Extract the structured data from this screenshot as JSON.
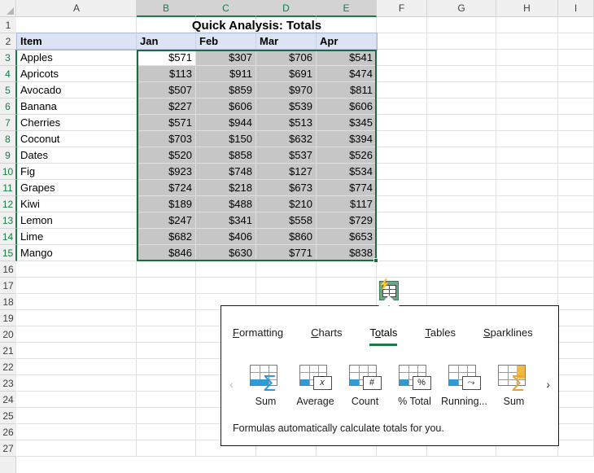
{
  "sheet": {
    "title": "Quick Analysis: Totals",
    "column_headers": [
      "A",
      "B",
      "C",
      "D",
      "E",
      "F",
      "G",
      "H",
      "I"
    ],
    "selected_columns": [
      "B",
      "C",
      "D",
      "E"
    ],
    "row_headers": [
      "1",
      "2",
      "3",
      "4",
      "5",
      "6",
      "7",
      "8",
      "9",
      "10",
      "11",
      "12",
      "13",
      "14",
      "15",
      "16",
      "17",
      "18",
      "19",
      "20",
      "21",
      "22",
      "23",
      "24",
      "25",
      "26",
      "27"
    ],
    "selected_rows": [
      "3",
      "4",
      "5",
      "6",
      "7",
      "8",
      "9",
      "10",
      "11",
      "12",
      "13",
      "14",
      "15"
    ],
    "table_headers": [
      "Item",
      "Jan",
      "Feb",
      "Mar",
      "Apr"
    ],
    "rows": [
      {
        "item": "Apples",
        "jan": "$571",
        "feb": "$307",
        "mar": "$706",
        "apr": "$541"
      },
      {
        "item": "Apricots",
        "jan": "$113",
        "feb": "$911",
        "mar": "$691",
        "apr": "$474"
      },
      {
        "item": "Avocado",
        "jan": "$507",
        "feb": "$859",
        "mar": "$970",
        "apr": "$811"
      },
      {
        "item": "Banana",
        "jan": "$227",
        "feb": "$606",
        "mar": "$539",
        "apr": "$606"
      },
      {
        "item": "Cherries",
        "jan": "$571",
        "feb": "$944",
        "mar": "$513",
        "apr": "$345"
      },
      {
        "item": "Coconut",
        "jan": "$703",
        "feb": "$150",
        "mar": "$632",
        "apr": "$394"
      },
      {
        "item": "Dates",
        "jan": "$520",
        "feb": "$858",
        "mar": "$537",
        "apr": "$526"
      },
      {
        "item": "Fig",
        "jan": "$923",
        "feb": "$748",
        "mar": "$127",
        "apr": "$534"
      },
      {
        "item": "Grapes",
        "jan": "$724",
        "feb": "$218",
        "mar": "$673",
        "apr": "$774"
      },
      {
        "item": "Kiwi",
        "jan": "$189",
        "feb": "$488",
        "mar": "$210",
        "apr": "$117"
      },
      {
        "item": "Lemon",
        "jan": "$247",
        "feb": "$341",
        "mar": "$558",
        "apr": "$729"
      },
      {
        "item": "Lime",
        "jan": "$682",
        "feb": "$406",
        "mar": "$860",
        "apr": "$653"
      },
      {
        "item": "Mango",
        "jan": "$846",
        "feb": "$630",
        "mar": "$771",
        "apr": "$838"
      }
    ],
    "active_cell": "B3",
    "selection_range": "B3:E15"
  },
  "quick_analysis": {
    "button_tooltip": "Quick Analysis",
    "tabs": [
      {
        "label": "Formatting",
        "accel": "F",
        "accel_index": 0,
        "active": false
      },
      {
        "label": "Charts",
        "accel": "C",
        "accel_index": 0,
        "active": false
      },
      {
        "label": "Totals",
        "accel": "o",
        "accel_index": 1,
        "active": true
      },
      {
        "label": "Tables",
        "accel": "T",
        "accel_index": 0,
        "active": false
      },
      {
        "label": "Sparklines",
        "accel": "S",
        "accel_index": 0,
        "active": false
      }
    ],
    "items": [
      {
        "label": "Sum",
        "icon": "sum-row-icon",
        "symbol": "∑",
        "style": "sigma-blue"
      },
      {
        "label": "Average",
        "icon": "average-icon",
        "symbol": "x",
        "style": "badge-xbar"
      },
      {
        "label": "Count",
        "icon": "count-icon",
        "symbol": "#",
        "style": "badge"
      },
      {
        "label": "% Total",
        "icon": "percent-total-icon",
        "symbol": "%",
        "style": "badge"
      },
      {
        "label": "Running...",
        "icon": "running-total-icon",
        "symbol": "⤳",
        "style": "badge"
      },
      {
        "label": "Sum",
        "icon": "sum-column-icon",
        "symbol": "∑",
        "style": "sigma-orange"
      }
    ],
    "scroll_left_icon": "‹",
    "scroll_right_icon": "›",
    "description": "Formulas automatically calculate totals for you.",
    "accent_color": "#1b7a46",
    "highlight_blue": "#2e9bd6",
    "highlight_orange": "#f5b942"
  }
}
